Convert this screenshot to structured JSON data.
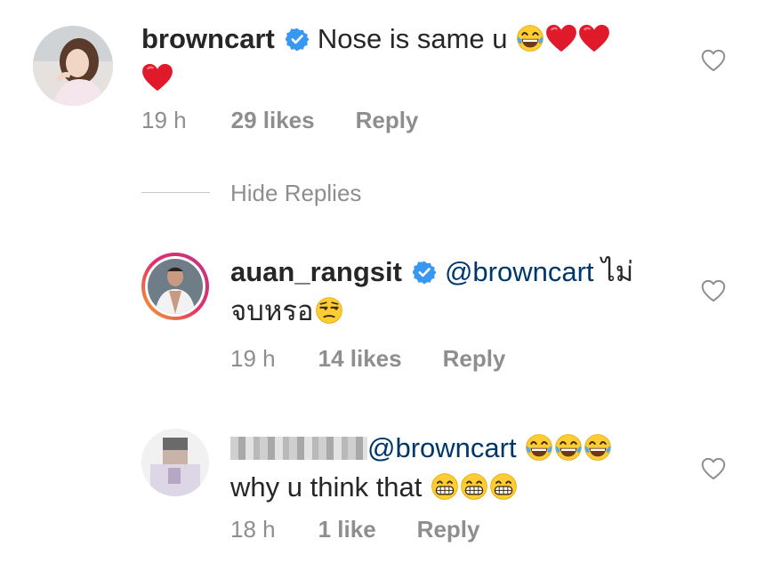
{
  "comments": [
    {
      "username": "browncart",
      "text": "Nose is same u",
      "time": "19 h",
      "likes": "29 likes",
      "reply": "Reply"
    },
    {
      "username": "auan_rangsit",
      "mention": "@browncart",
      "text_line1": "ไม่",
      "text_line2": "จบหรอ",
      "time": "19 h",
      "likes": "14 likes",
      "reply": "Reply"
    },
    {
      "mention": "@browncart",
      "text": "why u think that",
      "time": "18 h",
      "likes": "1 like",
      "reply": "Reply"
    }
  ],
  "hide_replies": "Hide Replies",
  "colors": {
    "verified": "#3897f0",
    "mention": "#00376b",
    "meta": "#8e8e8e",
    "heart_red": "#e0192b"
  },
  "icons": [
    "verified-badge-icon",
    "laughing-emoji-icon",
    "red-heart-emoji-icon",
    "unamused-emoji-icon",
    "grinning-emoji-icon",
    "like-heart-outline-icon"
  ]
}
